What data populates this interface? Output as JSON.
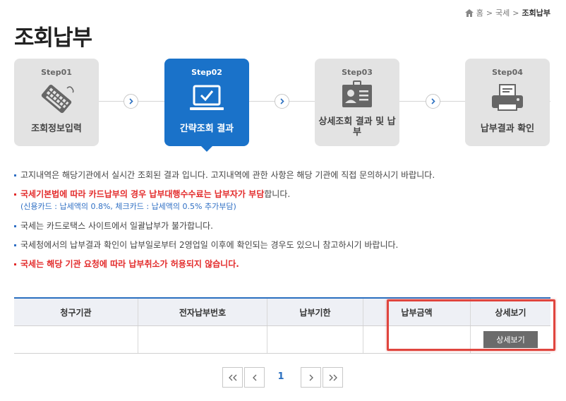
{
  "breadcrumb": {
    "home": "홈",
    "sep1": ">",
    "level1": "국세",
    "sep2": ">",
    "current": "조회납부"
  },
  "page_title": "조회납부",
  "steps": [
    {
      "num": "Step01",
      "label": "조회정보입력",
      "icon": "keyboard-icon",
      "active": false
    },
    {
      "num": "Step02",
      "label": "간략조회 결과",
      "icon": "laptop-check-icon",
      "active": true
    },
    {
      "num": "Step03",
      "label": "상세조회 결과 및 납부",
      "icon": "id-card-icon",
      "active": false
    },
    {
      "num": "Step04",
      "label": "납부결과 확인",
      "icon": "printer-icon",
      "active": false
    }
  ],
  "notices": {
    "n1": "고지내역은 해당기관에서 실시간 조회된 결과 입니다. 고지내역에 관한 사항은 해당 기관에 직접 문의하시기 바랍니다.",
    "n2_em": "국세기본법에 따라 카드납부의 경우 납부대행수수료는 납부자가 부담",
    "n2_rest": "합니다.",
    "n2_sub": "(신용카드 : 납세액의 0.8%, 체크카드 : 납세액의 0.5% 추가부담)",
    "n3": "국세는 카드로택스 사이트에서 일괄납부가 불가합니다.",
    "n4": "국세청에서의 납부결과 확인이 납부일로부터 2영업일 이후에 확인되는 경우도 있으니 참고하시기 바랍니다.",
    "n5": "국세는 해당 기관 요청에 따라 납부취소가 허용되지 않습니다."
  },
  "table": {
    "headers": [
      "청구기관",
      "전자납부번호",
      "납부기한",
      "납부금액",
      "상세보기"
    ],
    "rows": [
      {
        "institution": "",
        "payment_no": "",
        "due_date": "",
        "amount": "",
        "detail_button": "상세보기"
      }
    ]
  },
  "pager": {
    "first": "«",
    "prev": "‹",
    "current_page": "1",
    "next": "›",
    "last": "»"
  },
  "colors": {
    "accent": "#1a72c9",
    "warning": "#e32b2b",
    "bullet": "#2f6fc4",
    "highlight": "#e0453e"
  }
}
